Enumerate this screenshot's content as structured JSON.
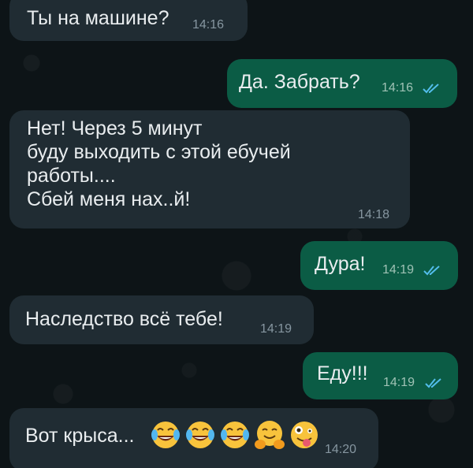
{
  "messages": [
    {
      "text": "Ты на машине?",
      "time": "14:16"
    },
    {
      "text": "Да. Забрать?",
      "time": "14:16",
      "ticks": "read-double-check-icon"
    },
    {
      "line1": "Нет! Через 5 минут",
      "line2": "буду выходить с этой ебучей",
      "line3": "работы....",
      "line4": "Сбей меня нах..й!",
      "time": "14:18"
    },
    {
      "text": "Дура!",
      "time": "14:19",
      "ticks": "read-double-check-icon"
    },
    {
      "text": "Наследство всё тебе!",
      "time": "14:19"
    },
    {
      "text": "Еду!!!",
      "time": "14:19",
      "ticks": "read-double-check-icon"
    },
    {
      "text": "Вот крыса...",
      "time": "14:20",
      "emojis": [
        "tears-of-joy-emoji",
        "tears-of-joy-emoji",
        "tears-of-joy-emoji",
        "hugging-face-emoji",
        "zany-face-emoji"
      ]
    }
  ],
  "colors": {
    "incoming_bubble": "#202c33",
    "outgoing_bubble": "#0b5c45",
    "read_ticks": "#53bdeb",
    "background": "#0d1417"
  }
}
